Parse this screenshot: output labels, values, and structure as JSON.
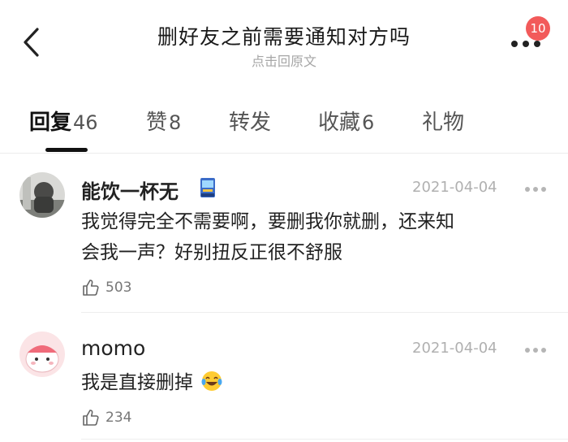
{
  "header": {
    "title": "删好友之前需要通知对方吗",
    "subtitle": "点击回原文",
    "notification_count": "10"
  },
  "tabs": [
    {
      "label": "回复",
      "count": "46"
    },
    {
      "label": "赞",
      "count": "8"
    },
    {
      "label": "转发",
      "count": ""
    },
    {
      "label": "收藏",
      "count": "6"
    },
    {
      "label": "礼物",
      "count": ""
    }
  ],
  "comments": [
    {
      "username": "能饮一杯无",
      "badge": "arcade-machine-icon",
      "date": "2021-04-04",
      "text_line1": "我觉得完全不需要啊，要删我你就删，还来知",
      "text_line2": "会我一声？好别扭反正很不舒服",
      "likes": "503"
    },
    {
      "username": "momo",
      "date": "2021-04-04",
      "text_line1": "我是直接删掉",
      "emoji": "tears-of-joy-icon",
      "likes": "234"
    }
  ],
  "colors": {
    "badge": "#f25a5a",
    "muted": "#b0b0b0",
    "text": "#222222"
  }
}
